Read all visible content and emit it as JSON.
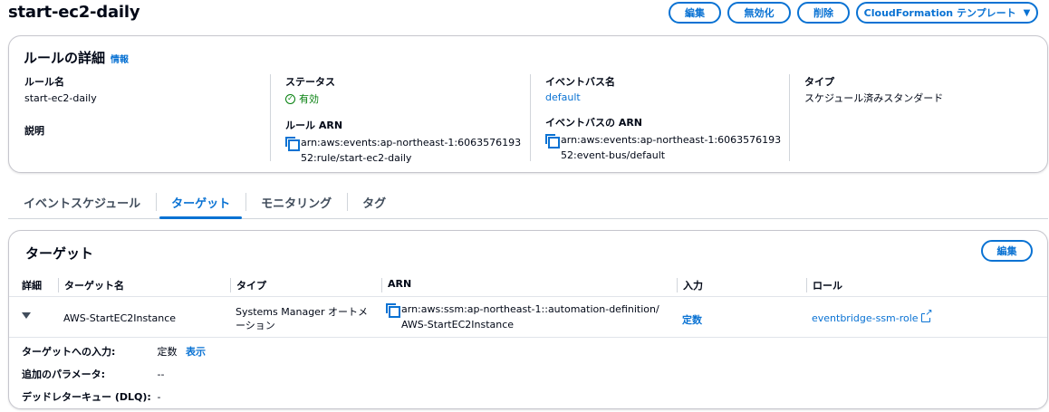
{
  "page": {
    "title": "start-ec2-daily"
  },
  "header_actions": {
    "edit": "編集",
    "disable": "無効化",
    "delete": "削除",
    "cloudformation": "CloudFormation テンプレート"
  },
  "rule_details": {
    "heading": "ルールの詳細",
    "info": "情報",
    "rule_name_label": "ルール名",
    "rule_name": "start-ec2-daily",
    "description_label": "説明",
    "status_label": "ステータス",
    "status": "有効",
    "rule_arn_label": "ルール ARN",
    "rule_arn": "arn:aws:events:ap-northeast-1:606357619352:rule/start-ec2-daily",
    "event_bus_label": "イベントバス名",
    "event_bus": "default",
    "event_bus_arn_label": "イベントバスの ARN",
    "event_bus_arn": "arn:aws:events:ap-northeast-1:606357619352:event-bus/default",
    "type_label": "タイプ",
    "type": "スケジュール済みスタンダード"
  },
  "tabs": [
    "イベントスケジュール",
    "ターゲット",
    "モニタリング",
    "タグ"
  ],
  "active_tab": "ターゲット",
  "targets": {
    "title": "ターゲット",
    "edit": "編集",
    "columns": {
      "detail": "詳細",
      "target_name": "ターゲット名",
      "type": "タイプ",
      "arn": "ARN",
      "input": "入力",
      "role": "ロール"
    },
    "rows": [
      {
        "target_name": "AWS-StartEC2Instance",
        "type": "Systems Manager オートメーション",
        "arn": "arn:aws:ssm:ap-northeast-1::automation-definition/AWS-StartEC2Instance",
        "input": "定数",
        "role": "eventbridge-ssm-role"
      }
    ],
    "expanded": {
      "input_label": "ターゲットへの入力:",
      "input_value": "定数",
      "input_show": "表示",
      "params_label": "追加のパラメータ:",
      "params_value": "--",
      "dlq_label": "デッドレターキュー (DLQ):",
      "dlq_value": "-"
    }
  },
  "colors": {
    "accent": "#0972d3",
    "success": "#037f0c",
    "text": "#000716",
    "border": "#c6c6cd"
  },
  "icons": {
    "copy": "copy-icon",
    "status": "status-positive-icon",
    "external": "external-link-icon",
    "expand": "caret-down-icon",
    "dropdown": "caret-down-icon"
  }
}
